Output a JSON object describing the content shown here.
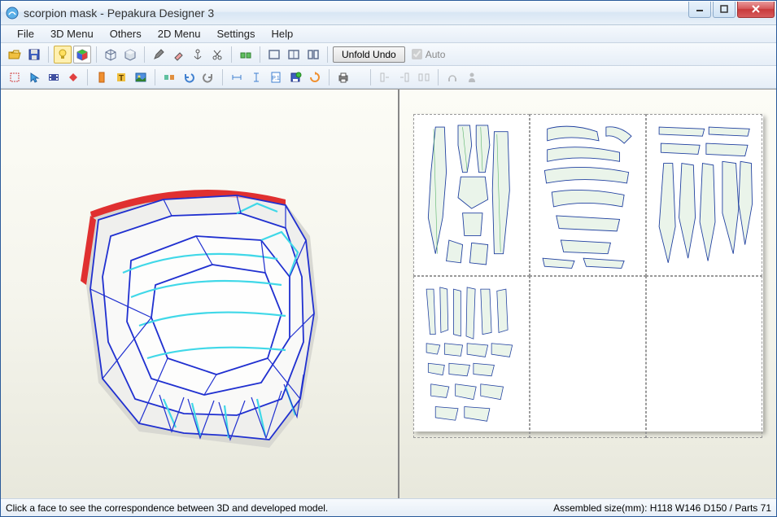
{
  "window": {
    "title": "scorpion mask - Pepakura Designer 3"
  },
  "menu": {
    "items": [
      "File",
      "3D Menu",
      "Others",
      "2D Menu",
      "Settings",
      "Help"
    ]
  },
  "toolbar1": {
    "unfold_undo": "Unfold Undo",
    "auto_label": "Auto",
    "auto_checked": true
  },
  "statusbar": {
    "hint": "Click a face to see the correspondence between 3D and developed model.",
    "info": "Assembled size(mm): H118 W146 D150 / Parts 71"
  },
  "colors": {
    "title_accent": "#2f6fb5",
    "wire_primary": "#2030d0",
    "wire_highlight": "#40d8e8",
    "wire_edge": "#d02020",
    "part_stroke": "#2030a0",
    "part_fill": "#dff0df"
  }
}
